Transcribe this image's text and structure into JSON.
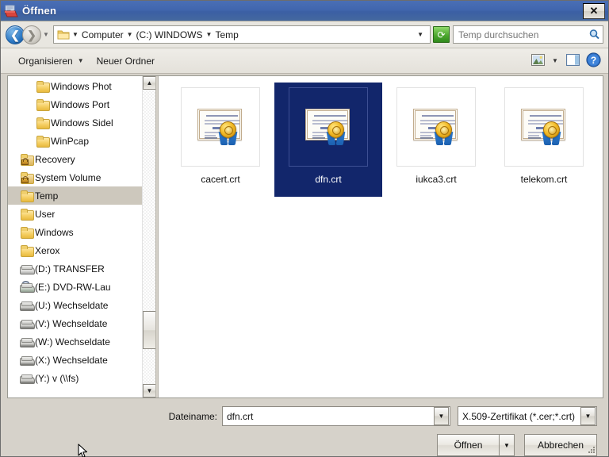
{
  "window": {
    "title": "Öffnen",
    "icon": "open-folder-icon",
    "close_label": "✕"
  },
  "addressbar": {
    "back_icon": "back-arrow-icon",
    "forward_icon": "forward-arrow-icon",
    "recent_icon": "chevron-down-icon",
    "folder_icon": "folder-icon",
    "breadcrumbs": [
      "Computer",
      "(C:) WINDOWS",
      "Temp"
    ],
    "separator": "▼",
    "dropdown_icon": "chevron-down-icon",
    "refresh_icon": "refresh-icon",
    "refresh_glyph": "⟳",
    "search_placeholder": "Temp durchsuchen",
    "search_value": "",
    "search_icon": "search-icon"
  },
  "toolbar": {
    "organize_label": "Organisieren",
    "organize_caret": "▼",
    "new_folder_label": "Neuer Ordner",
    "view_icon": "view-mode-icon",
    "view_caret": "▼",
    "preview_icon": "preview-pane-icon",
    "help_icon": "help-icon",
    "help_glyph": "?"
  },
  "sidebar": {
    "scroll_up_glyph": "▲",
    "scroll_down_glyph": "▼",
    "items": [
      {
        "label": "Windows Phot",
        "icon": "folder-icon",
        "depth": 1,
        "selected": false
      },
      {
        "label": "Windows Port",
        "icon": "folder-icon",
        "depth": 1,
        "selected": false
      },
      {
        "label": "Windows Sidel",
        "icon": "folder-icon",
        "depth": 1,
        "selected": false
      },
      {
        "label": "WinPcap",
        "icon": "folder-icon",
        "depth": 1,
        "selected": false
      },
      {
        "label": "Recovery",
        "icon": "locked-folder-icon",
        "depth": 0,
        "selected": false
      },
      {
        "label": "System Volume",
        "icon": "locked-folder-icon",
        "depth": 0,
        "selected": false
      },
      {
        "label": "Temp",
        "icon": "folder-icon",
        "depth": 0,
        "selected": true
      },
      {
        "label": "User",
        "icon": "folder-icon",
        "depth": 0,
        "selected": false
      },
      {
        "label": "Windows",
        "icon": "folder-icon",
        "depth": 0,
        "selected": false
      },
      {
        "label": "Xerox",
        "icon": "folder-icon",
        "depth": 0,
        "selected": false
      },
      {
        "label": "(D:) TRANSFER",
        "icon": "drive-icon",
        "depth": 0,
        "selected": false
      },
      {
        "label": "(E:) DVD-RW-Lau",
        "icon": "dvd-drive-icon",
        "depth": 0,
        "selected": false
      },
      {
        "label": "(U:) Wechseldate",
        "icon": "removable-drive-icon",
        "depth": 0,
        "selected": false
      },
      {
        "label": "(V:) Wechseldate",
        "icon": "removable-drive-icon",
        "depth": 0,
        "selected": false
      },
      {
        "label": "(W:) Wechseldate",
        "icon": "removable-drive-icon",
        "depth": 0,
        "selected": false
      },
      {
        "label": "(X:) Wechseldate",
        "icon": "removable-drive-icon",
        "depth": 0,
        "selected": false
      },
      {
        "label": "(Y:) v (\\\\fs)",
        "icon": "network-drive-icon",
        "depth": 0,
        "selected": false
      }
    ]
  },
  "files": [
    {
      "name": "cacert.crt",
      "icon": "certificate-icon",
      "selected": false
    },
    {
      "name": "dfn.crt",
      "icon": "certificate-icon",
      "selected": true
    },
    {
      "name": "iukca3.crt",
      "icon": "certificate-icon",
      "selected": false
    },
    {
      "name": "telekom.crt",
      "icon": "certificate-icon",
      "selected": false
    }
  ],
  "bottom": {
    "filename_label": "Dateiname:",
    "filename_value": "dfn.crt",
    "filename_dropdown_icon": "chevron-down-icon",
    "filter_value": "X.509-Zertifikat (*.cer;*.crt)",
    "filter_dropdown_icon": "chevron-down-icon",
    "open_label": "Öffnen",
    "open_dropdown_icon": "chevron-down-icon",
    "cancel_label": "Abbrechen",
    "caret_glyph": "▼",
    "cursor_icon": "mouse-cursor",
    "resize_grip_icon": "resize-grip-icon"
  },
  "colors": {
    "titlebar": "#4166ae",
    "selection": "#12266b",
    "tree_selection": "#cdc8bd",
    "chrome": "#d6d2ca",
    "refresh_green": "#4ea82f"
  }
}
